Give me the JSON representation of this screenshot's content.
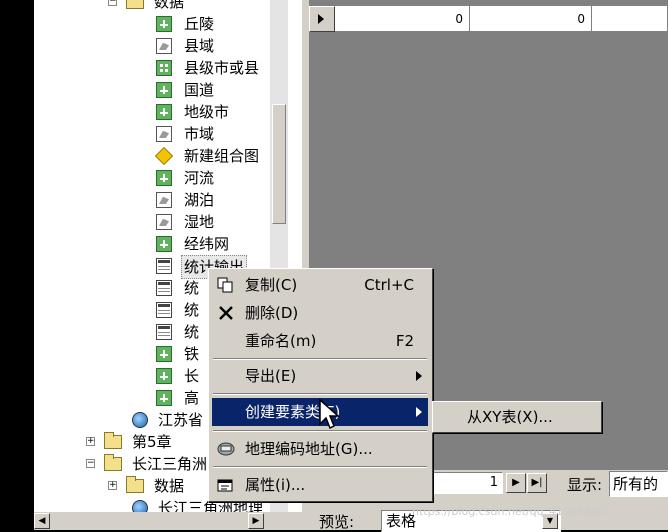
{
  "tree": {
    "items": [
      {
        "label": "数据",
        "icon": "folder-icon"
      },
      {
        "label": "丘陵",
        "icon": "feature-class-icon"
      },
      {
        "label": "县域",
        "icon": "polygon-feature-icon"
      },
      {
        "label": "县级市或县",
        "icon": "point-feature-icon"
      },
      {
        "label": "国道",
        "icon": "feature-class-icon"
      },
      {
        "label": "地级市",
        "icon": "feature-class-icon"
      },
      {
        "label": "市域",
        "icon": "polygon-feature-icon"
      },
      {
        "label": "新建组合图",
        "icon": "topology-icon"
      },
      {
        "label": "河流",
        "icon": "feature-class-icon"
      },
      {
        "label": "湖泊",
        "icon": "polygon-feature-icon"
      },
      {
        "label": "湿地",
        "icon": "polygon-feature-icon"
      },
      {
        "label": "经纬网",
        "icon": "feature-class-icon"
      },
      {
        "label": "统计输出",
        "icon": "table-icon"
      },
      {
        "label": "统",
        "icon": "table-icon"
      },
      {
        "label": "统",
        "icon": "table-icon"
      },
      {
        "label": "统",
        "icon": "table-icon"
      },
      {
        "label": "铁",
        "icon": "feature-class-icon"
      },
      {
        "label": "长",
        "icon": "feature-class-icon"
      },
      {
        "label": "高",
        "icon": "feature-class-icon"
      },
      {
        "label": "江苏省",
        "icon": "geodatabase-icon"
      },
      {
        "label": "第5章",
        "icon": "folder-icon"
      },
      {
        "label": "长江三角洲",
        "icon": "folder-icon"
      },
      {
        "label": "数据",
        "icon": "folder-icon"
      },
      {
        "label": "长江三角洲地理",
        "icon": "geodatabase-icon"
      }
    ]
  },
  "grid": {
    "cells": [
      "0",
      "0"
    ]
  },
  "bottombar": {
    "record_value": "1",
    "show_label": "显示:",
    "show_value": "所有的",
    "preview_label": "预览:",
    "preview_value": "表格",
    "nav_next": "▶",
    "nav_last": "▶|"
  },
  "context_menu": {
    "items": [
      {
        "label": "复制(C)",
        "shortcut": "Ctrl+C",
        "icon": "copy-icon"
      },
      {
        "label": "删除(D)",
        "shortcut": "",
        "icon": "delete-icon"
      },
      {
        "label": "重命名(m)",
        "shortcut": "F2",
        "icon": ""
      },
      {
        "label": "导出(E)",
        "shortcut": "",
        "icon": ""
      },
      {
        "label": "创建要素类(F)",
        "shortcut": "",
        "icon": ""
      },
      {
        "label": "地理编码地址(G)...",
        "shortcut": "",
        "icon": "geocode-icon"
      },
      {
        "label": "属性(i)...",
        "shortcut": "",
        "icon": "properties-icon"
      }
    ],
    "highlighted": "创建要素类(F)"
  },
  "submenu": {
    "items": [
      {
        "label": "从XY表(X)..."
      }
    ]
  },
  "watermark": "https://blog.csdn.net/qq_41985880"
}
